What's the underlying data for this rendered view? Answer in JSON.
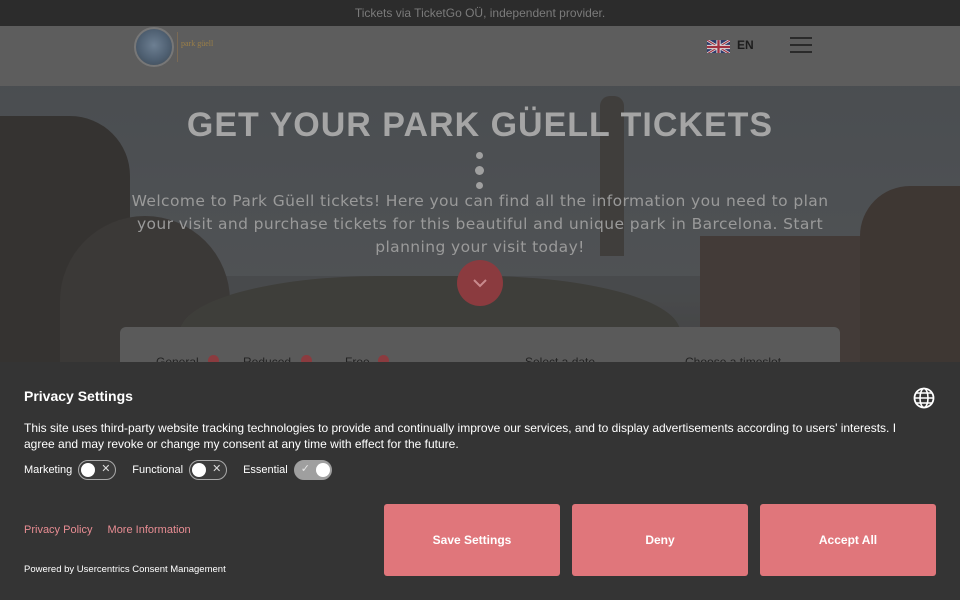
{
  "topbar": {
    "text": "Tickets via TicketGo OÜ, independent provider."
  },
  "header": {
    "logo_text": "park güell",
    "language": "EN",
    "flag_icon": "uk-flag-icon",
    "menu_icon": "hamburger-icon"
  },
  "hero": {
    "title": "GET YOUR PARK GÜELL TICKETS",
    "description": "Welcome to Park Güell tickets! Here you can find all the information you need to plan your visit and purchase tickets for this beautiful and unique park in Barcelona. Start planning your visit today!",
    "scroll_icon": "chevron-down-icon"
  },
  "booking": {
    "ticket_types": [
      "General",
      "Reduced",
      "Free"
    ],
    "date_label": "Select a date",
    "time_label": "Choose a timeslot"
  },
  "consent": {
    "title": "Privacy Settings",
    "text": "This site uses third-party website tracking technologies to provide and continually improve our services, and to display advertisements according to users' interests. I agree and may revoke or change my consent at any time with effect for the future.",
    "toggles": [
      {
        "label": "Marketing",
        "on": false
      },
      {
        "label": "Functional",
        "on": false
      },
      {
        "label": "Essential",
        "on": true
      }
    ],
    "links": [
      "Privacy Policy",
      "More Information"
    ],
    "powered_by": "Powered by Usercentrics Consent Management",
    "buttons": {
      "save": "Save Settings",
      "deny": "Deny",
      "accept": "Accept All"
    },
    "accent_color": "#e0767b"
  }
}
